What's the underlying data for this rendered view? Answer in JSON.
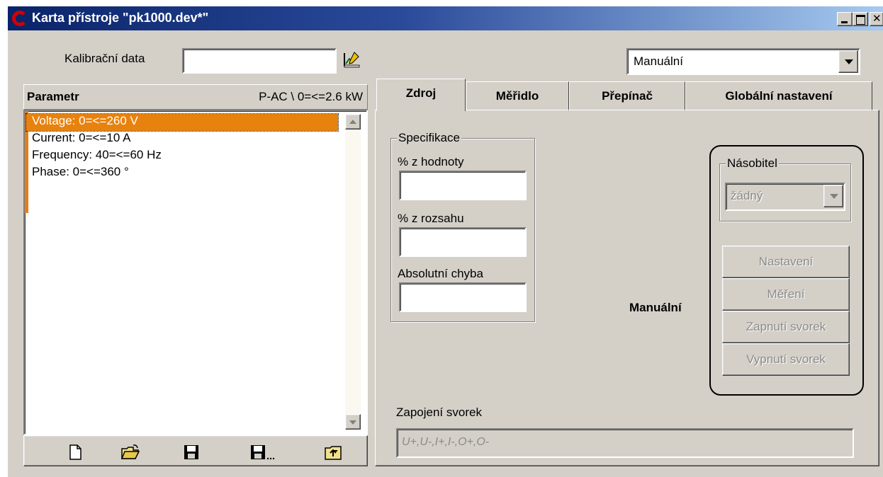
{
  "window": {
    "title": "Karta přístroje \"pk1000.dev*\"",
    "controls": [
      "minimize",
      "maximize",
      "close"
    ]
  },
  "calibration": {
    "label": "Kalibrační data",
    "value": "",
    "edit_icon": "edit-chart-icon"
  },
  "mode_select": {
    "value": "Manuální"
  },
  "parameters": {
    "header_left": "Parametr",
    "header_right": "P-AC \\ 0=<=2.6 kW",
    "items": [
      {
        "label": "Voltage: 0=<=260 V",
        "selected": true
      },
      {
        "label": "Current: 0=<=10 A",
        "selected": false
      },
      {
        "label": "Frequency: 40=<=60 Hz",
        "selected": false
      },
      {
        "label": "Phase: 0=<=360 °",
        "selected": false
      }
    ],
    "accent_color": "#e8820e"
  },
  "toolbar": {
    "icons": [
      "new-file-icon",
      "open-folder-icon",
      "save-icon",
      "save-as-icon",
      "up-folder-icon"
    ]
  },
  "tabs": [
    {
      "label": "Zdroj",
      "active": true
    },
    {
      "label": "Měřidlo",
      "active": false
    },
    {
      "label": "Přepínač",
      "active": false
    },
    {
      "label": "Globální nastavení",
      "active": false
    }
  ],
  "specification": {
    "title": "Specifikace",
    "fields": [
      {
        "label": "% z hodnoty",
        "value": ""
      },
      {
        "label": "% z rozsahu",
        "value": ""
      },
      {
        "label": "Absolutní chyba",
        "value": ""
      }
    ]
  },
  "manual_label": "Manuální",
  "multiplier": {
    "title": "Násobitel",
    "value": "žádný"
  },
  "disabled_buttons": [
    "Nastavení",
    "Měření",
    "Zapnutí svorek",
    "Vypnutí svorek"
  ],
  "terminals": {
    "label": "Zapojení svorek",
    "value": "U+,U-,I+,I-,O+,O-"
  }
}
